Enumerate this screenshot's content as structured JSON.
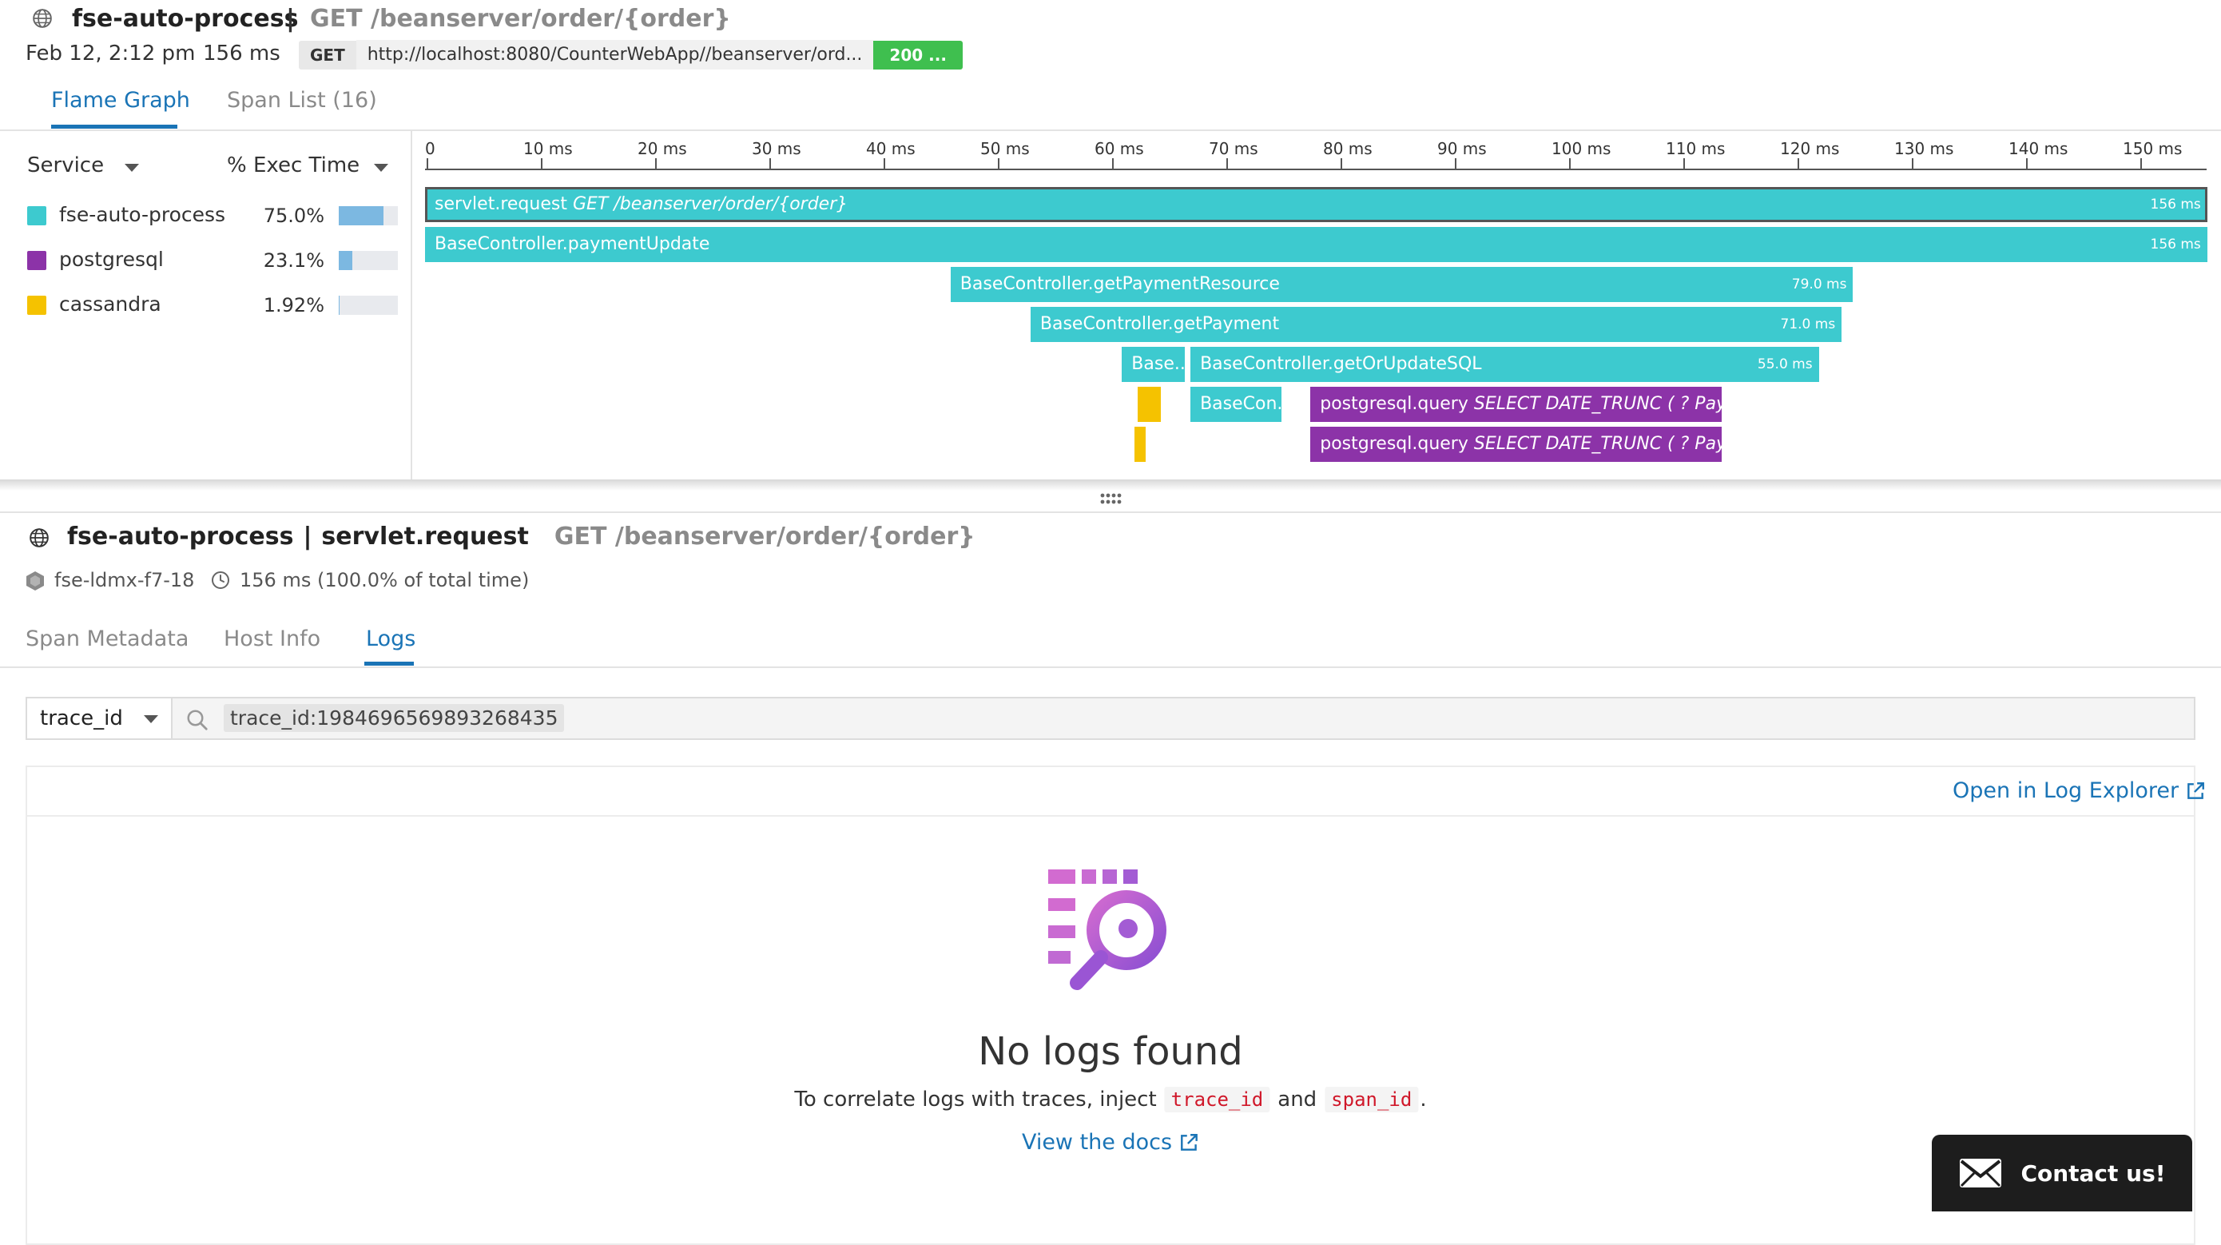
{
  "header": {
    "service": "fse-auto-process",
    "separator": "|",
    "resource": "GET /beanserver/order/{order}",
    "date": "Feb 12, 2:12 pm",
    "duration": "156 ms",
    "method": "GET",
    "url": "http://localhost:8080/CounterWebApp//beanserver/ord...",
    "status": "200 ..."
  },
  "top_tabs": [
    {
      "label": "Flame Graph",
      "active": true
    },
    {
      "label": "Span List (16)",
      "active": false
    }
  ],
  "legend": {
    "col_service": "Service",
    "col_exec": "% Exec Time",
    "items": [
      {
        "name": "fse-auto-process",
        "pct": "75.0%",
        "fraction": 0.75,
        "color": "#3dcacf"
      },
      {
        "name": "postgresql",
        "pct": "23.1%",
        "fraction": 0.231,
        "color": "#8c33a8"
      },
      {
        "name": "cassandra",
        "pct": "1.92%",
        "fraction": 0.0192,
        "color": "#f5c200"
      }
    ]
  },
  "timeline": {
    "max_ms": 156,
    "ticks": [
      "0",
      "10 ms",
      "20 ms",
      "30 ms",
      "40 ms",
      "50 ms",
      "60 ms",
      "70 ms",
      "80 ms",
      "90 ms",
      "100 ms",
      "110 ms",
      "120 ms",
      "130 ms",
      "140 ms",
      "150 ms"
    ]
  },
  "spans": [
    {
      "name": "servlet.request",
      "resource": "GET /beanserver/order/{order}",
      "start": 0,
      "dur": 156,
      "level": 0,
      "color": "teal",
      "label": "156 ms",
      "selected": true
    },
    {
      "name": "BaseController.paymentUpdate",
      "resource": "",
      "start": 0,
      "dur": 156,
      "level": 1,
      "color": "teal",
      "label": "156 ms"
    },
    {
      "name": "BaseController.getPaymentResource",
      "resource": "",
      "start": 46,
      "dur": 79,
      "level": 2,
      "color": "teal",
      "label": "79.0 ms"
    },
    {
      "name": "BaseController.getPayment",
      "resource": "",
      "start": 53,
      "dur": 71,
      "level": 3,
      "color": "teal",
      "label": "71.0 ms"
    },
    {
      "name": "Base...",
      "resource": "",
      "start": 61,
      "dur": 5.5,
      "level": 4,
      "color": "teal",
      "label": ""
    },
    {
      "name": "BaseController.getOrUpdateSQL",
      "resource": "",
      "start": 67,
      "dur": 55,
      "level": 4,
      "color": "teal",
      "label": "55.0 ms"
    },
    {
      "name": "",
      "resource": "",
      "start": 62.4,
      "dur": 2,
      "level": 5,
      "color": "yellow",
      "label": ""
    },
    {
      "name": "BaseCon...",
      "resource": "",
      "start": 67,
      "dur": 8,
      "level": 5,
      "color": "teal",
      "label": ""
    },
    {
      "name": "postgresql.query",
      "resource": "SELECT DATE_TRUNC ( ? Payment.",
      "start": 77.5,
      "dur": 36,
      "level": 5,
      "color": "purple",
      "label": ""
    },
    {
      "name": "",
      "resource": "",
      "start": 62.1,
      "dur": 1,
      "level": 6,
      "color": "yellow",
      "label": ""
    },
    {
      "name": "postgresql.query",
      "resource": "SELECT DATE_TRUNC ( ? Payment.",
      "start": 77.5,
      "dur": 36,
      "level": 6,
      "color": "purple",
      "label": ""
    }
  ],
  "detail": {
    "service": "fse-auto-process",
    "separator": "|",
    "operation": "servlet.request",
    "resource": "GET /beanserver/order/{order}",
    "host": "fse-ldmx-f7-18",
    "time": "156 ms (100.0% of total time)"
  },
  "detail_tabs": [
    {
      "label": "Span Metadata",
      "active": false
    },
    {
      "label": "Host Info",
      "active": false
    },
    {
      "label": "Logs",
      "active": true
    }
  ],
  "logs": {
    "facet_select": "trace_id",
    "query": "trace_id:1984696569893268435",
    "open_explorer": "Open in Log Explorer",
    "empty_title": "No logs found",
    "hint_prefix": "To correlate logs with traces, inject",
    "hint_code1": "trace_id",
    "hint_and": "and",
    "hint_code2": "span_id",
    "hint_suffix": ".",
    "docs_link": "View the docs"
  },
  "contact": {
    "label": "Contact us!"
  }
}
